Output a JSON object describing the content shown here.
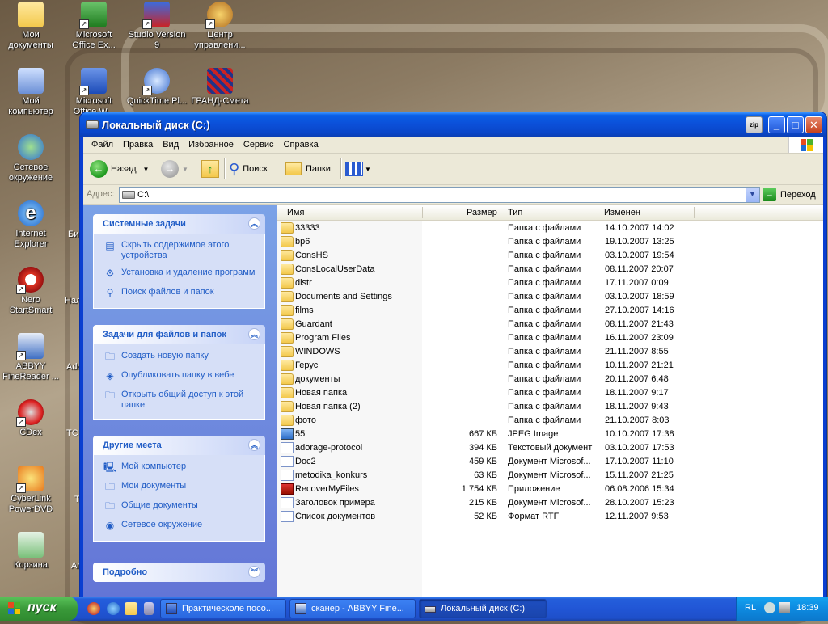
{
  "desktop": {
    "icons": [
      {
        "label": "Мои документы"
      },
      {
        "label": "Microsoft Office Ex..."
      },
      {
        "label": "Studio Version 9"
      },
      {
        "label": "Центр управлени..."
      },
      {
        "label": "Мой компьютер"
      },
      {
        "label": "Microsoft Office W..."
      },
      {
        "label": "QuickTime Pl..."
      },
      {
        "label": "ГРАНД-Смета"
      },
      {
        "label": "Сетевое окружение"
      },
      {
        "label": "Internet Explorer"
      },
      {
        "label": "Nero StartSmart"
      },
      {
        "label": "ABBYY FineReader ..."
      },
      {
        "label": "CDex"
      },
      {
        "label": "CyberLink PowerDVD"
      },
      {
        "label": "Корзина"
      }
    ],
    "partial_labels": [
      "Би",
      "Нал",
      "Ado",
      "TC",
      "T",
      "Ar"
    ]
  },
  "window": {
    "title": "Локальный диск (C:)",
    "zip_label": "zip",
    "menu": [
      "Файл",
      "Правка",
      "Вид",
      "Избранное",
      "Сервис",
      "Справка"
    ],
    "toolbar": {
      "back": "Назад",
      "search": "Поиск",
      "folders": "Папки"
    },
    "address": {
      "label": "Адрес:",
      "value": "C:\\",
      "go": "Переход"
    },
    "panels": [
      {
        "title": "Системные задачи",
        "tasks": [
          "Скрыть содержимое этого устройства",
          "Установка и удаление программ",
          "Поиск файлов и папок"
        ]
      },
      {
        "title": "Задачи для файлов и папок",
        "tasks": [
          "Создать новую папку",
          "Опубликовать папку в вебе",
          "Открыть общий доступ к этой папке"
        ]
      },
      {
        "title": "Другие места",
        "tasks": [
          "Мой компьютер",
          "Мои документы",
          "Общие документы",
          "Сетевое окружение"
        ]
      },
      {
        "title": "Подробно",
        "tasks": []
      }
    ],
    "columns": {
      "name": "Имя",
      "size": "Размер",
      "type": "Тип",
      "modified": "Изменен"
    },
    "files": [
      {
        "name": "33333",
        "size": "",
        "type": "Папка с файлами",
        "modified": "14.10.2007 14:02",
        "icon": "folder"
      },
      {
        "name": "bp6",
        "size": "",
        "type": "Папка с файлами",
        "modified": "19.10.2007 13:25",
        "icon": "folder"
      },
      {
        "name": "ConsHS",
        "size": "",
        "type": "Папка с файлами",
        "modified": "03.10.2007 19:54",
        "icon": "folder"
      },
      {
        "name": "ConsLocalUserData",
        "size": "",
        "type": "Папка с файлами",
        "modified": "08.11.2007 20:07",
        "icon": "folder"
      },
      {
        "name": "distr",
        "size": "",
        "type": "Папка с файлами",
        "modified": "17.11.2007 0:09",
        "icon": "folder"
      },
      {
        "name": "Documents and Settings",
        "size": "",
        "type": "Папка с файлами",
        "modified": "03.10.2007 18:59",
        "icon": "folder"
      },
      {
        "name": "films",
        "size": "",
        "type": "Папка с файлами",
        "modified": "27.10.2007 14:16",
        "icon": "folder"
      },
      {
        "name": "Guardant",
        "size": "",
        "type": "Папка с файлами",
        "modified": "08.11.2007 21:43",
        "icon": "folder"
      },
      {
        "name": "Program Files",
        "size": "",
        "type": "Папка с файлами",
        "modified": "16.11.2007 23:09",
        "icon": "folder"
      },
      {
        "name": "WINDOWS",
        "size": "",
        "type": "Папка с файлами",
        "modified": "21.11.2007 8:55",
        "icon": "folder"
      },
      {
        "name": "Герус",
        "size": "",
        "type": "Папка с файлами",
        "modified": "10.11.2007 21:21",
        "icon": "folder"
      },
      {
        "name": "документы",
        "size": "",
        "type": "Папка с файлами",
        "modified": "20.11.2007 6:48",
        "icon": "folder"
      },
      {
        "name": "Новая папка",
        "size": "",
        "type": "Папка с файлами",
        "modified": "18.11.2007 9:17",
        "icon": "folder"
      },
      {
        "name": "Новая папка (2)",
        "size": "",
        "type": "Папка с файлами",
        "modified": "18.11.2007 9:43",
        "icon": "folder"
      },
      {
        "name": "фото",
        "size": "",
        "type": "Папка с файлами",
        "modified": "21.10.2007 8:03",
        "icon": "folder"
      },
      {
        "name": "55",
        "size": "667 КБ",
        "type": "JPEG Image",
        "modified": "10.10.2007 17:38",
        "icon": "img"
      },
      {
        "name": "adorage-protocol",
        "size": "394 КБ",
        "type": "Текстовый документ",
        "modified": "03.10.2007 17:53",
        "icon": "doc"
      },
      {
        "name": "Doc2",
        "size": "459 КБ",
        "type": "Документ Microsof...",
        "modified": "17.10.2007 11:10",
        "icon": "doc"
      },
      {
        "name": "metodika_konkurs",
        "size": "63 КБ",
        "type": "Документ Microsof...",
        "modified": "15.11.2007 21:25",
        "icon": "doc"
      },
      {
        "name": "RecoverMyFiles",
        "size": "1 754 КБ",
        "type": "Приложение",
        "modified": "06.08.2006 15:34",
        "icon": "app"
      },
      {
        "name": "Заголовок примера",
        "size": "215 КБ",
        "type": "Документ Microsof...",
        "modified": "28.10.2007 15:23",
        "icon": "doc"
      },
      {
        "name": "Список документов",
        "size": "52 КБ",
        "type": "Формат RTF",
        "modified": "12.11.2007 9:53",
        "icon": "doc"
      }
    ]
  },
  "taskbar": {
    "start": "пуск",
    "tasks": [
      {
        "label": "Практическоле посо..."
      },
      {
        "label": "сканер - ABBYY Fine..."
      },
      {
        "label": "Локальный диск (C:)"
      }
    ],
    "tray": {
      "lang": "RL",
      "time": "18:39"
    }
  }
}
